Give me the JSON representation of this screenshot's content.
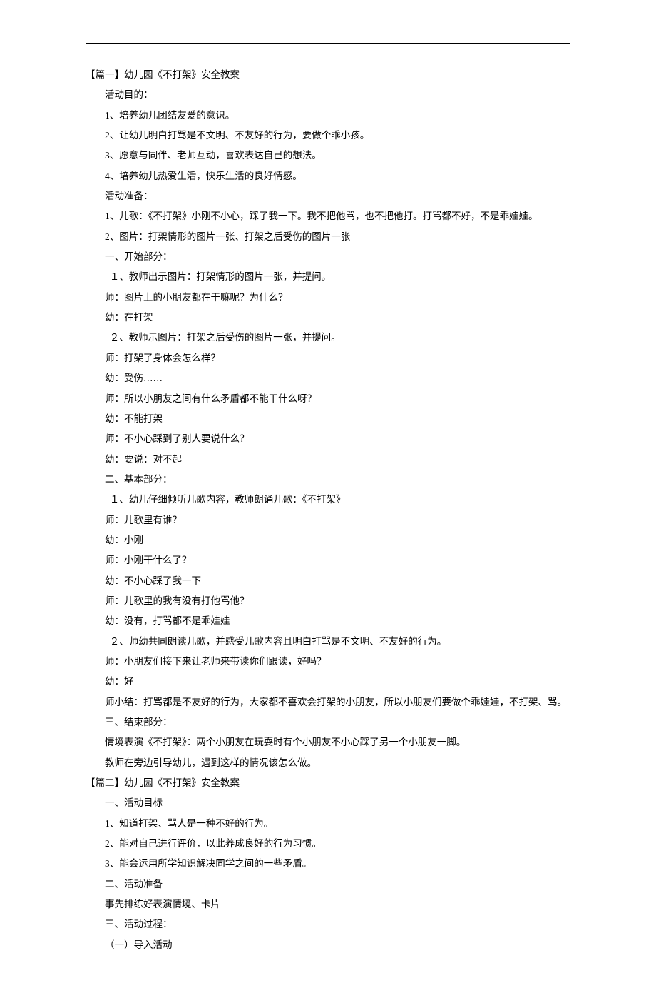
{
  "section1": {
    "title": "【篇一】幼儿园《不打架》安全教案",
    "lines": [
      "活动目的：",
      "1、培养幼儿团结友爱的意识。",
      "2、让幼儿明白打骂是不文明、不友好的行为，要做个乖小孩。",
      "3、愿意与同伴、老师互动，喜欢表达自己的想法。",
      "4、培养幼儿热爱生活，快乐生活的良好情感。",
      "活动准备：",
      "1、儿歌：《不打架》小刚不小心，踩了我一下。我不把他骂，也不把他打。打骂都不好，不是乖娃娃。",
      "2、图片：打架情形的图片一张、打架之后受伤的图片一张",
      "一、开始部分：",
      "１、教师出示图片：打架情形的图片一张，并提问。",
      "师：图片上的小朋友都在干嘛呢？为什么？",
      "幼：在打架",
      "２、教师示图片：打架之后受伤的图片一张，并提问。",
      "师：打架了身体会怎么样？",
      "幼：受伤……",
      "师：所以小朋友之间有什么矛盾都不能干什么呀？",
      "幼：不能打架",
      "师：不小心踩到了别人要说什么？",
      "幼：要说：对不起",
      "二、基本部分：",
      "１、幼儿仔细倾听儿歌内容，教师朗诵儿歌：《不打架》",
      "师：儿歌里有谁？",
      "幼：小刚",
      "师：小刚干什么了？",
      "幼：不小心踩了我一下",
      "师：儿歌里的我有没有打他骂他？",
      "幼：没有，打骂都不是乖娃娃",
      "２、师幼共同朗读儿歌，并感受儿歌内容且明白打骂是不文明、不友好的行为。",
      "师：小朋友们接下来让老师来带读你们跟读，好吗？",
      "幼：好",
      "师小结：打骂都是不友好的行为，大家都不喜欢会打架的小朋友，所以小朋友们要做个乖娃娃，不打架、骂。",
      "三、结束部分：",
      "情境表演《不打架》：两个小朋友在玩耍时有个小朋友不小心踩了另一个小朋友一脚。",
      "教师在旁边引导幼儿，遇到这样的情况该怎么做。"
    ]
  },
  "section2": {
    "title": "【篇二】幼儿园《不打架》安全教案",
    "lines": [
      "一、活动目标",
      "1、知道打架、骂人是一种不好的行为。",
      "2、能对自己进行评价，以此养成良好的行为习惯。",
      "3、能会运用所学知识解决同学之间的一些矛盾。",
      "二、活动准备",
      "事先排练好表演情境、卡片",
      "三、活动过程：",
      "（一）导入活动"
    ]
  }
}
